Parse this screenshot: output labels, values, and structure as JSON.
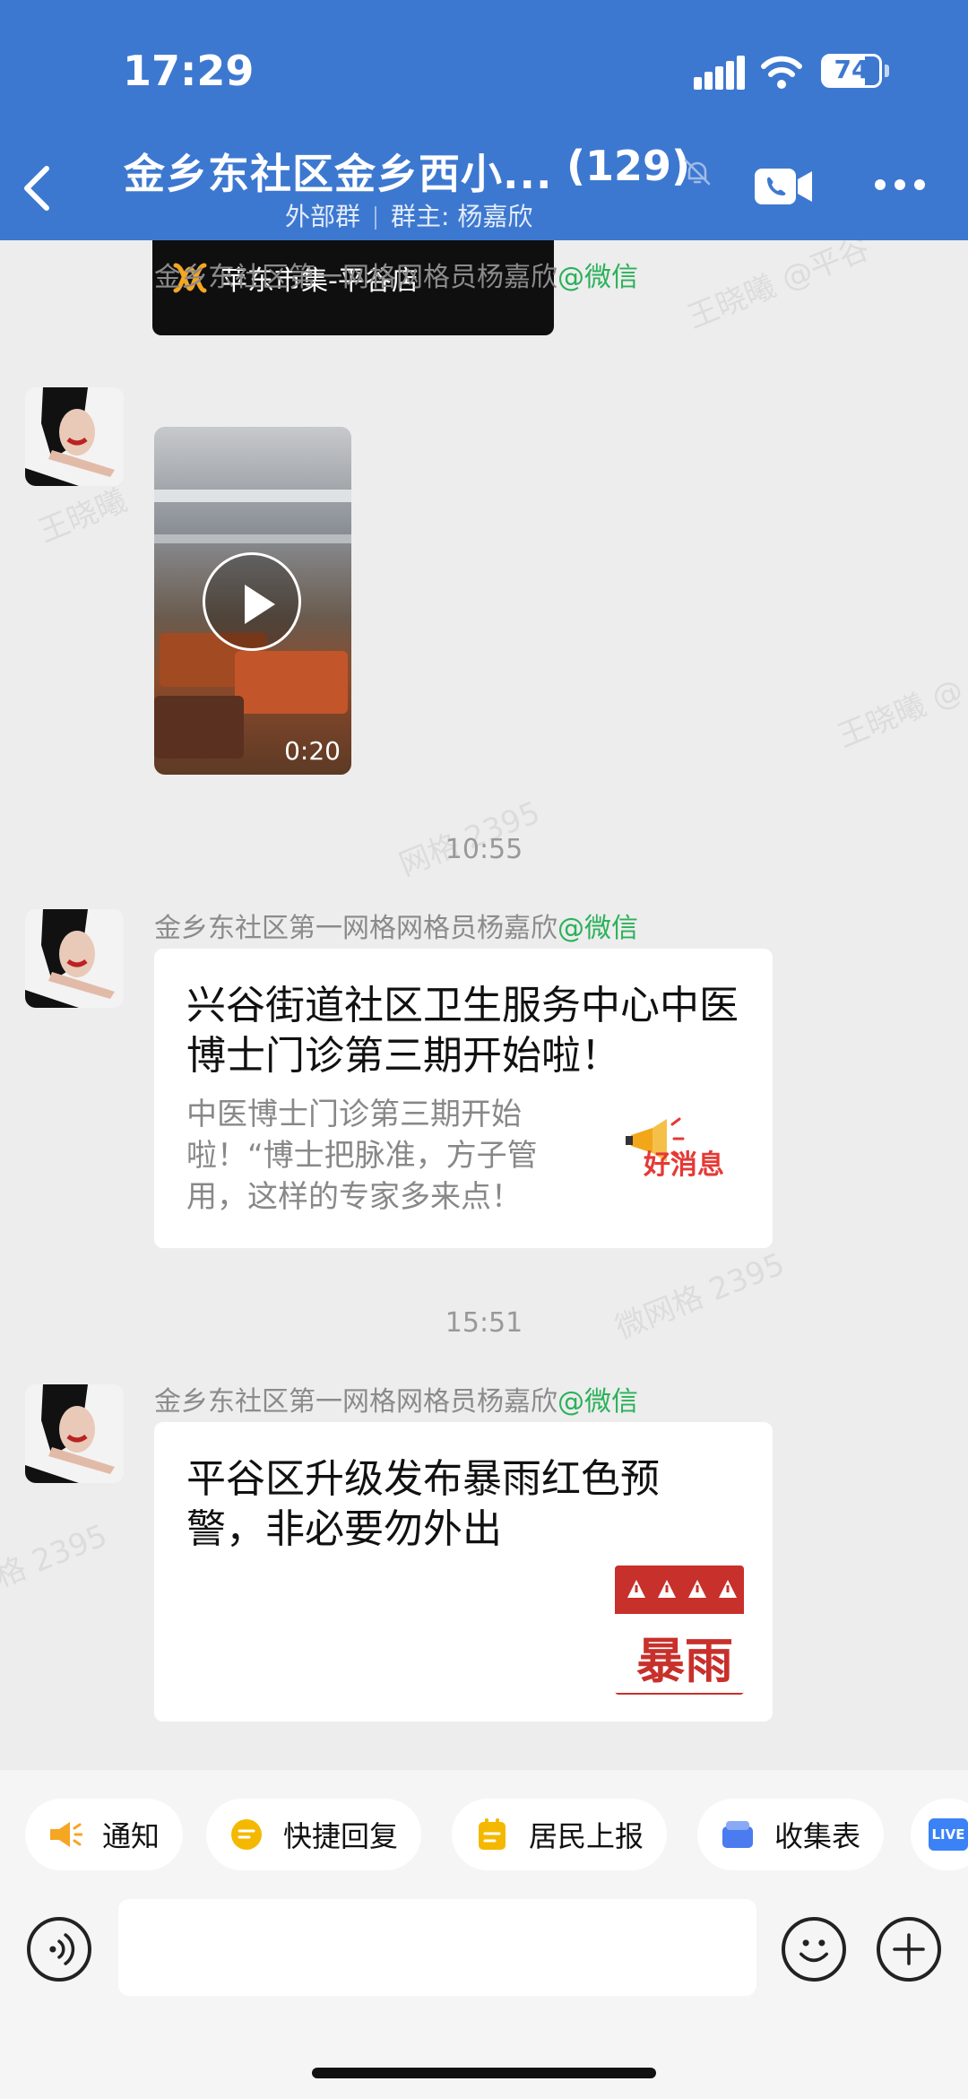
{
  "status_bar": {
    "time": "17:29",
    "battery": "74",
    "battery_level": 0.74
  },
  "header": {
    "title": "金乡东社区金乡西小...",
    "member_count": "(129)",
    "tag": "外部群",
    "owner": "群主: 杨嘉欣"
  },
  "store_card": {
    "name": "苹东市集-平谷店"
  },
  "messages": [
    {
      "sender": "金乡东社区第一网格网格员杨嘉欣",
      "sender_tag": "@微信",
      "type": "video",
      "duration": "0:20"
    },
    {
      "timestamp": "10:55",
      "sender": "金乡东社区第一网格网格员杨嘉欣",
      "sender_tag": "@微信",
      "type": "link",
      "title": "兴谷街道社区卫生服务中心中医博士门诊第三期开始啦！",
      "desc": "中医博士门诊第三期开始啦！“博士把脉准，方子管用，这样的专家多来点！",
      "thumb_text": "好消息"
    },
    {
      "timestamp": "15:51",
      "sender": "金乡东社区第一网格网格员杨嘉欣",
      "sender_tag": "@微信",
      "type": "link",
      "title": "平谷区升级发布暴雨红色预警，非必要勿外出",
      "thumb_text": "暴雨"
    }
  ],
  "quick_actions": [
    {
      "label": "通知",
      "icon": "megaphone-icon",
      "color": "#F5A623"
    },
    {
      "label": "快捷回复",
      "icon": "quick-reply-icon",
      "color": "#F5B800"
    },
    {
      "label": "居民上报",
      "icon": "clipboard-icon",
      "color": "#F5B800"
    },
    {
      "label": "收集表",
      "icon": "collection-form-icon",
      "color": "#4A7CF0"
    },
    {
      "label": "LIVE",
      "icon": "live-icon",
      "color": "#3B82F6"
    }
  ],
  "colors": {
    "header": "#3D78D0",
    "wechat_green": "#2BB15A",
    "alert_red": "#C8302B"
  }
}
